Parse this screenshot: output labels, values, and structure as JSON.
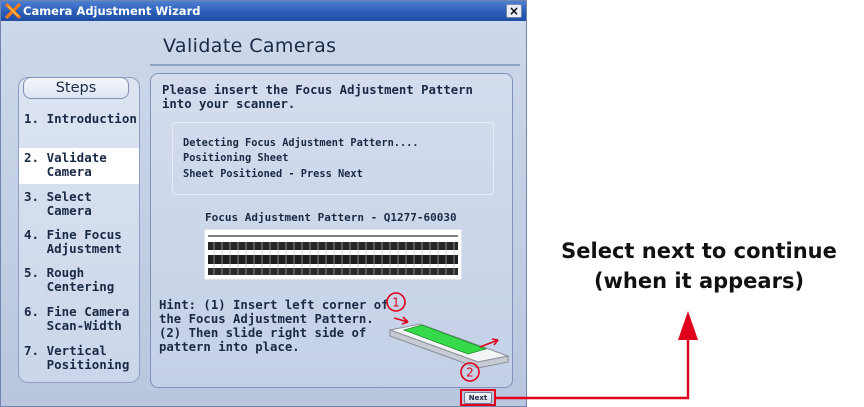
{
  "window": {
    "title": "Camera Adjustment Wizard",
    "close_label": "×",
    "colors": {
      "titlebar": "#2a5db8",
      "client": "#bcc8df",
      "accent_red": "#e0001b"
    }
  },
  "page": {
    "title": "Validate Cameras"
  },
  "steps": {
    "header": "Steps",
    "items": [
      {
        "label": "1. Introduction",
        "active": false
      },
      {
        "label": "2. Validate\n   Camera",
        "active": true
      },
      {
        "label": "3. Select\n   Camera",
        "active": false
      },
      {
        "label": "4. Fine Focus\n   Adjustment",
        "active": false
      },
      {
        "label": "5. Rough\n   Centering",
        "active": false
      },
      {
        "label": "6. Fine Camera\n   Scan-Width",
        "active": false
      },
      {
        "label": "7. Vertical\n   Positioning",
        "active": false
      }
    ]
  },
  "main": {
    "instruction": "Please insert the Focus Adjustment Pattern into your scanner.",
    "status": [
      "Detecting Focus Adjustment Pattern....",
      "Positioning Sheet",
      "Sheet Positioned - Press Next"
    ],
    "pattern_label": "Focus Adjustment Pattern - Q1277-60030",
    "hint": "Hint: (1) Insert left corner of\nthe Focus Adjustment Pattern.\n(2) Then slide right side of\npattern into place.",
    "markers": [
      "1",
      "2"
    ]
  },
  "footer": {
    "next_label": "Next"
  },
  "annotation": {
    "line1": "Select next to continue",
    "line2": "(when it appears)"
  }
}
